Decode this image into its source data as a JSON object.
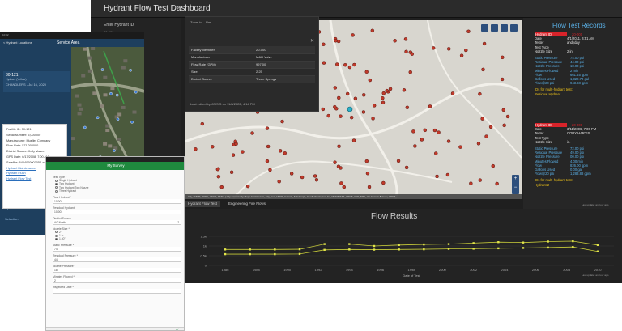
{
  "dashboard": {
    "title": "Hydrant Flow Test Dashboard",
    "left_panel": {
      "label": "Enter Hydrant ID",
      "value": "20-000"
    },
    "map": {
      "tools": [
        "Zoom to",
        "Pan"
      ],
      "attribution": "City, TNRIS, TXDA, USGS, FEMA | City Community Maps Contributors, City, Esri, HERE, Garmin, SafeGraph, GeoTechnologies, Inc, METI/NASA, USGS, EPA, NPS, US Census Bureau, USDA",
      "powered": "Powered by Esri",
      "close_icon": "close-icon",
      "popup": {
        "rows": [
          {
            "k": "Facility Identifier",
            "v": "20-000"
          },
          {
            "k": "Manufacturer",
            "v": "M&H Valve"
          },
          {
            "k": "Flow Rate (GPM)",
            "v": "997.00"
          },
          {
            "k": "Size",
            "v": "2.25"
          },
          {
            "k": "District Source",
            "v": "Three Springs"
          }
        ],
        "footer": "Last edited by JCISIS on 11/8/2022, 4:14 PM"
      }
    },
    "records": {
      "title": "Flow Test Records",
      "record1": {
        "id_label": "Hydrant ID",
        "id_value": "20-000",
        "rows": [
          {
            "k": "Date",
            "v": "4/1/2011, 4:51 AM"
          },
          {
            "k": "Tester",
            "v": "andyday"
          },
          {
            "k": "Test Type",
            "v": ""
          },
          {
            "k": "Nozzle Size",
            "v": "2 in."
          }
        ],
        "measures": [
          {
            "k": "Static Pressure",
            "v": "74.00 psi"
          },
          {
            "k": "Residual Pressure",
            "v": "44.00 psi"
          },
          {
            "k": "Nozzle Pressure",
            "v": "18.00 psi"
          },
          {
            "k": "Minutes Flowed",
            "v": "2 min"
          },
          {
            "k": "Flow",
            "v": "661.45 gpm"
          },
          {
            "k": "Gallons Used",
            "v": "1,322.70 gal"
          },
          {
            "k": "Flow@20 psi",
            "v": "943.68 gpm"
          }
        ],
        "multi_label": "IDs for multi-hydrant test:",
        "multi_value": "Residual Hydrant"
      },
      "record2": {
        "id_label": "Hydrant ID",
        "id_value": "20-000",
        "rows": [
          {
            "k": "Date",
            "v": "3/11/2006, 7:00 PM"
          },
          {
            "k": "Tester",
            "v": "CORY HARTIS"
          },
          {
            "k": "Test Type",
            "v": ""
          },
          {
            "k": "Nozzle Size",
            "v": "in."
          }
        ],
        "measures": [
          {
            "k": "Static Pressure",
            "v": "72.00 psi"
          },
          {
            "k": "Residual Pressure",
            "v": "49.00 psi"
          },
          {
            "k": "Nozzle Pressure",
            "v": "00.00 psi"
          },
          {
            "k": "Minutes Flowed",
            "v": "4.00 min"
          },
          {
            "k": "Flow",
            "v": "826.00 gpm"
          },
          {
            "k": "Gallons Used",
            "v": "0.00 gal"
          },
          {
            "k": "Flow@20 psi",
            "v": "1,283.88 gpm"
          }
        ],
        "multi_label": "IDs for multi-hydrant test:",
        "multi_value": "Hydrant 2"
      },
      "updated": "Last update: an hour ago"
    },
    "tabs": [
      "Hydrant Flow Test",
      "Engineering Fire Flows"
    ],
    "flow_updated": "Last update: an hour ago"
  },
  "chart_data": {
    "type": "line",
    "title": "Flow Results",
    "xlabel": "Date of Test",
    "ylabel": "",
    "x": [
      "1986",
      "1988",
      "1990",
      "1992",
      "1994",
      "1996",
      "1998",
      "2000",
      "2002",
      "2004",
      "2006",
      "2008",
      "2010"
    ],
    "ylim": [
      0,
      2
    ],
    "yticks": [
      "0",
      "0.5k",
      "1k",
      "1.5k"
    ],
    "series": [
      {
        "values": [
          0.82,
          0.82,
          0.82,
          0.83,
          1.1,
          1.1,
          1.0,
          1.05,
          1.08,
          1.1,
          1.15,
          1.2,
          1.18,
          1.23,
          1.25,
          1.05
        ]
      },
      {
        "values": [
          0.58,
          0.58,
          0.58,
          0.59,
          0.8,
          0.82,
          0.81,
          0.82,
          0.83,
          0.85,
          0.86,
          0.88,
          0.9,
          0.92,
          0.95,
          0.72
        ]
      }
    ]
  },
  "tablet": {
    "status_left": "10:32",
    "status_right": "",
    "back_label": "< Hydrant Locations",
    "header": "Service Area",
    "card": {
      "id": "30-121",
      "sub": "Hydrant (Yellow)",
      "date": "CHANDLERS - Jul 16, 2020"
    },
    "detail_rows": [
      "Facility ID: 30-121",
      "Serial Number: 5,000000",
      "Manufacturer: Mueller Company",
      "Flow Rate: 571.000000",
      "District Source: Kelly Vance",
      "GPS Date: 6/17/2008, 7:00 AM",
      "Satellite: 6404000007054-xx"
    ],
    "detail_links": [
      "Hydrant Maintenance",
      "Hydrant Flush",
      "Hydrant Flow Test"
    ],
    "nav": [
      "Help",
      "Inspections",
      "Operations",
      "Selection"
    ]
  },
  "survey": {
    "header": "My Survey",
    "test_type_label": "Test Type *",
    "options": [
      "Single Hydrant",
      "Two Hydrant",
      "Two Hydrant Two Nozzle",
      "Three Hydrant"
    ],
    "selected_option": 1,
    "fields": [
      {
        "label": "Flow Hydrant *",
        "value": "10-001"
      },
      {
        "label": "Residual Hydrant",
        "value": "10-001"
      },
      {
        "label": "District Source",
        "value": "AG North"
      },
      {
        "label": "Nozzle Size *",
        "value": ""
      },
      {
        "label": "Static Pressure *",
        "value": "74"
      },
      {
        "label": "Residual Pressure *",
        "value": "44"
      },
      {
        "label": "Nozzle Pressure *",
        "value": "18"
      },
      {
        "label": "Minutes Flowed *",
        "value": "2"
      },
      {
        "label": "Inspected Date *",
        "value": ""
      }
    ],
    "nozzle_options": [
      "2\"",
      "1 in",
      "1.50\""
    ],
    "nozzle_selected": 2
  }
}
